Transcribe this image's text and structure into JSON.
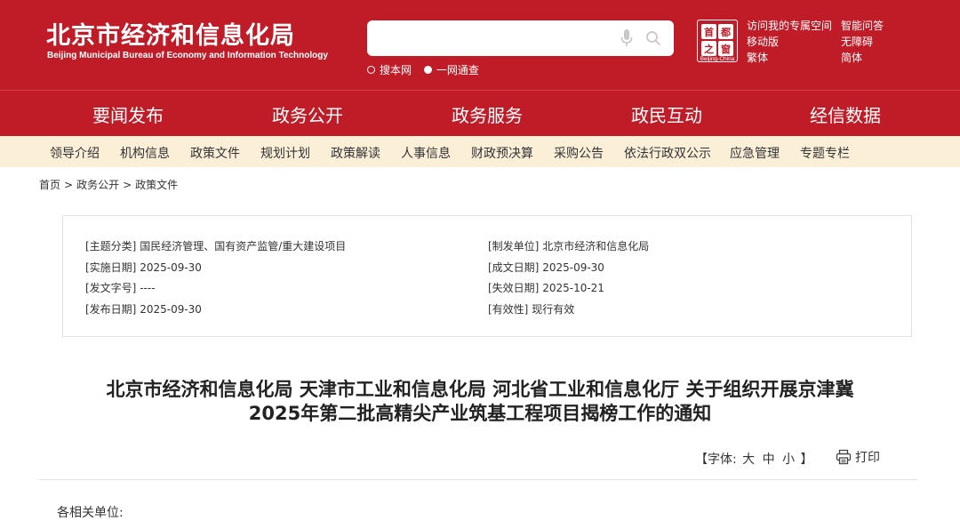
{
  "header": {
    "title_cn": "北京市经济和信息化局",
    "title_en": "Beijing Municipal Bureau of Economy and Information Technology",
    "search": {
      "placeholder": "",
      "options": [
        {
          "label": "搜本网",
          "selected": false
        },
        {
          "label": "一网通查",
          "selected": true
        }
      ]
    },
    "emblem": {
      "chars": [
        "首",
        "都",
        "之",
        "窗"
      ],
      "caption": "Beijing-China"
    },
    "links_left": [
      "访问我的专属空间",
      "移动版",
      "繁体"
    ],
    "links_right": [
      "智能问答",
      "无障碍",
      "简体"
    ],
    "brand_color": "#c01c28"
  },
  "main_nav": [
    "要闻发布",
    "政务公开",
    "政务服务",
    "政民互动",
    "经信数据"
  ],
  "sub_nav": [
    "领导介绍",
    "机构信息",
    "政策文件",
    "规划计划",
    "政策解读",
    "人事信息",
    "财政预决算",
    "采购公告",
    "依法行政双公示",
    "应急管理",
    "专题专栏"
  ],
  "breadcrumb": [
    "首页",
    "政务公开",
    "政策文件"
  ],
  "breadcrumb_sep": ">",
  "meta": {
    "left": [
      {
        "label": "[主题分类]",
        "value": "国民经济管理、国有资产监管/重大建设项目"
      },
      {
        "label": "[实施日期]",
        "value": "2025-09-30"
      },
      {
        "label": "[发文字号]",
        "value": "----"
      },
      {
        "label": "[发布日期]",
        "value": "2025-09-30"
      }
    ],
    "right": [
      {
        "label": "[制发单位]",
        "value": "北京市经济和信息化局"
      },
      {
        "label": "[成文日期]",
        "value": "2025-09-30"
      },
      {
        "label": "[失效日期]",
        "value": "2025-10-21"
      },
      {
        "label": "[有效性]",
        "value": "现行有效"
      }
    ]
  },
  "article": {
    "title_line1": "北京市经济和信息化局 天津市工业和信息化局 河北省工业和信息化厅 关于组织开展京津冀",
    "title_line2": "2025年第二批高精尖产业筑基工程项目揭榜工作的通知",
    "font_size": {
      "open": "【字体:",
      "options": [
        "大",
        "中",
        "小"
      ],
      "close": "】"
    },
    "print_label": "打印",
    "addressee": "各相关单位:"
  }
}
